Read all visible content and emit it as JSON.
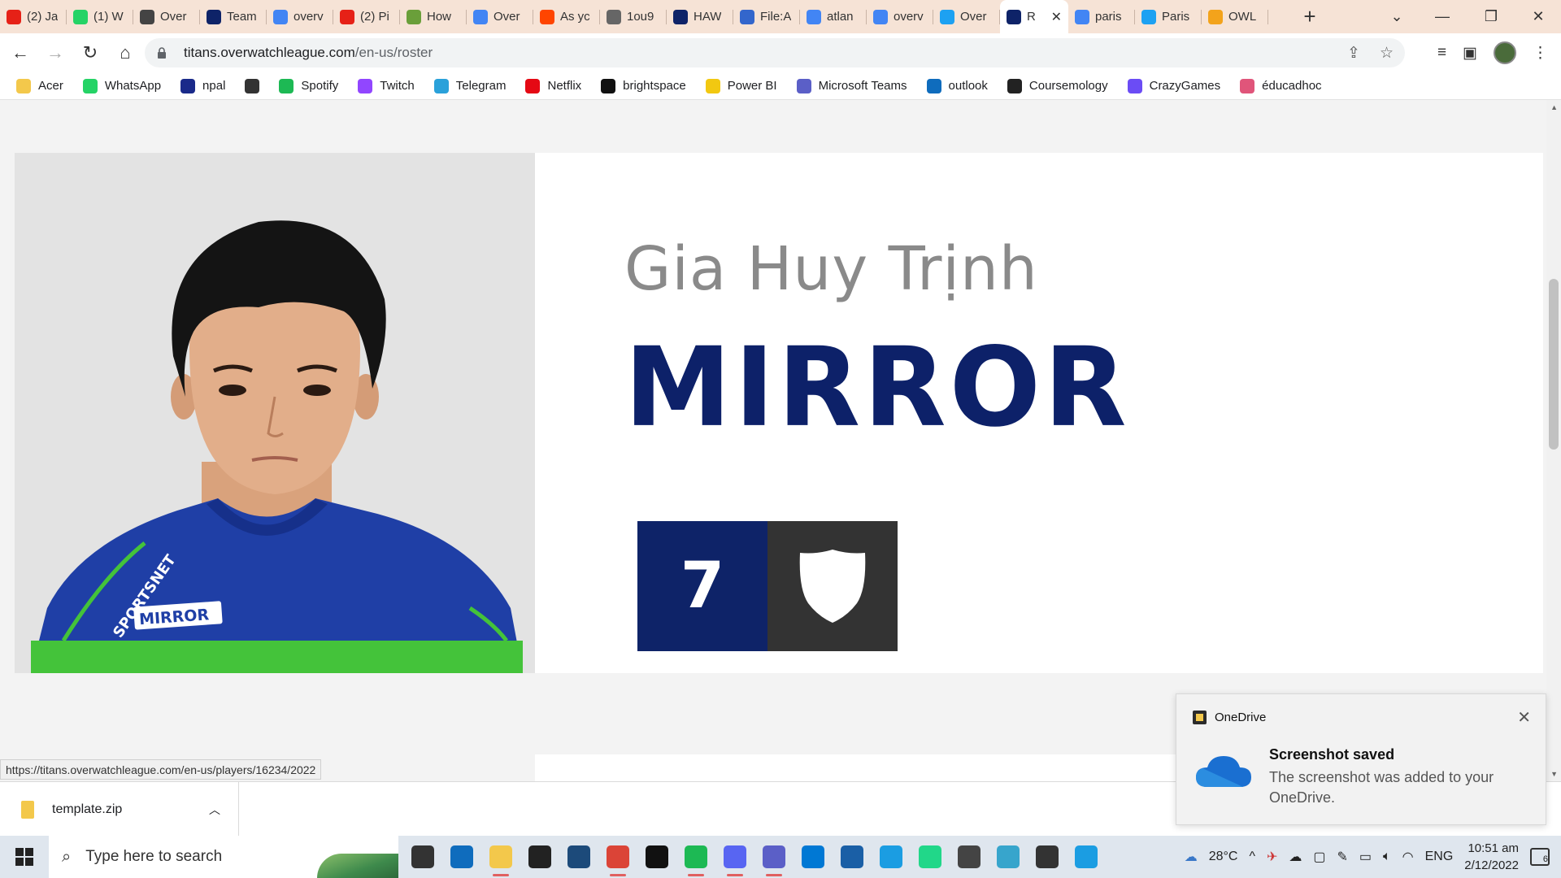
{
  "browser": {
    "tabs": [
      {
        "label": "(2) Ja",
        "icon": "youtube-icon",
        "color": "#e62117"
      },
      {
        "label": "(1) W",
        "icon": "whatsapp-icon",
        "color": "#25d366"
      },
      {
        "label": "Over",
        "icon": "overwatch-icon",
        "color": "#444444"
      },
      {
        "label": "Team",
        "icon": "titans-icon",
        "color": "#0e2368"
      },
      {
        "label": "overv",
        "icon": "google-icon",
        "color": "#4285f4"
      },
      {
        "label": "(2) Pi",
        "icon": "youtube-icon",
        "color": "#e62117"
      },
      {
        "label": "How",
        "icon": "wikihow-icon",
        "color": "#6a9f3a"
      },
      {
        "label": "Over",
        "icon": "google-icon",
        "color": "#4285f4"
      },
      {
        "label": "As yc",
        "icon": "reddit-icon",
        "color": "#ff4500"
      },
      {
        "label": "1ou9",
        "icon": "globe-icon",
        "color": "#666666"
      },
      {
        "label": "HAW",
        "icon": "titans-icon",
        "color": "#0e2368"
      },
      {
        "label": "File:A",
        "icon": "wikimedia-icon",
        "color": "#3366cc"
      },
      {
        "label": "atlan",
        "icon": "google-icon",
        "color": "#4285f4"
      },
      {
        "label": "overv",
        "icon": "google-icon",
        "color": "#4285f4"
      },
      {
        "label": "Over",
        "icon": "twitter-icon",
        "color": "#1da1f2"
      },
      {
        "label": "R",
        "icon": "titans-icon",
        "color": "#0e2368",
        "active": true
      },
      {
        "label": "paris",
        "icon": "google-icon",
        "color": "#4285f4"
      },
      {
        "label": "Paris",
        "icon": "twitter-icon",
        "color": "#1da1f2"
      },
      {
        "label": "OWL",
        "icon": "owl-icon",
        "color": "#f3a31b"
      }
    ],
    "url_host": "titans.overwatchleague.com",
    "url_path": "/en-us/roster",
    "bookmarks": [
      {
        "label": "Acer",
        "icon": "folder-icon",
        "color": "#f3c84b"
      },
      {
        "label": "WhatsApp",
        "icon": "whatsapp-icon",
        "color": "#25d366"
      },
      {
        "label": "npal",
        "icon": "npal-icon",
        "color": "#1a2a8a"
      },
      {
        "label": "",
        "icon": "globe-icon",
        "color": "#333333"
      },
      {
        "label": "Spotify",
        "icon": "spotify-icon",
        "color": "#1db954"
      },
      {
        "label": "Twitch",
        "icon": "twitch-icon",
        "color": "#9146ff"
      },
      {
        "label": "Telegram",
        "icon": "telegram-icon",
        "color": "#2aa1da"
      },
      {
        "label": "Netflix",
        "icon": "netflix-icon",
        "color": "#e50914"
      },
      {
        "label": "brightspace",
        "icon": "np-icon",
        "color": "#111111"
      },
      {
        "label": "Power BI",
        "icon": "powerbi-icon",
        "color": "#f2c811"
      },
      {
        "label": "Microsoft Teams",
        "icon": "teams-icon",
        "color": "#5b5fc7"
      },
      {
        "label": "outlook",
        "icon": "outlook-icon",
        "color": "#0f6cbd"
      },
      {
        "label": "Coursemology",
        "icon": "coursemology-icon",
        "color": "#222222"
      },
      {
        "label": "CrazyGames",
        "icon": "crazygames-icon",
        "color": "#6b4cf5"
      },
      {
        "label": "éducadhoc",
        "icon": "educadhoc-icon",
        "color": "#e0557a"
      }
    ]
  },
  "player": {
    "full_name": "Gia Huy Trịnh",
    "handle": "MIRROR",
    "number": "7",
    "role_icon": "support-shield-icon",
    "jersey_label": "MIRROR",
    "jersey_sponsor": "SPORTSNET",
    "colors": {
      "navy": "#0e2368",
      "role_bg": "#333333",
      "jersey_blue": "#1f3fa6",
      "jersey_green": "#44c33a"
    }
  },
  "status_url": "https://titans.overwatchleague.com/en-us/players/16234/2022",
  "download": {
    "file": "template.zip"
  },
  "toast": {
    "app": "OneDrive",
    "title": "Screenshot saved",
    "body": "The screenshot was added to your OneDrive."
  },
  "taskbar": {
    "search_placeholder": "Type here to search",
    "apps": [
      {
        "icon": "task-view-icon",
        "color": "#333333"
      },
      {
        "icon": "mail-icon",
        "color": "#0f6cbd"
      },
      {
        "icon": "file-explorer-icon",
        "color": "#f3c84b",
        "running": true
      },
      {
        "icon": "dropbox-icon",
        "color": "#222222"
      },
      {
        "icon": "store-icon",
        "color": "#1c4a7a"
      },
      {
        "icon": "chrome-icon",
        "color": "#db4437",
        "running": true
      },
      {
        "icon": "netflix-icon",
        "color": "#111111"
      },
      {
        "icon": "spotify-icon",
        "color": "#1db954",
        "running": true
      },
      {
        "icon": "discord-icon",
        "color": "#5865f2",
        "running": true
      },
      {
        "icon": "teams-icon",
        "color": "#5b5fc7",
        "running": true
      },
      {
        "icon": "vscode-icon",
        "color": "#0078d4"
      },
      {
        "icon": "photos-icon",
        "color": "#1a5fa6"
      },
      {
        "icon": "edge-icon",
        "color": "#1b9de2"
      },
      {
        "icon": "pycharm-icon",
        "color": "#21d789"
      },
      {
        "icon": "unity-icon",
        "color": "#444444"
      },
      {
        "icon": "maya-icon",
        "color": "#37a5cc"
      },
      {
        "icon": "unity-hub-icon",
        "color": "#333333"
      },
      {
        "icon": "edge-dev-icon",
        "color": "#1b9de2"
      }
    ],
    "weather": "28°C",
    "language": "ENG",
    "time": "10:51 am",
    "date": "2/12/2022",
    "notifications": "6"
  }
}
